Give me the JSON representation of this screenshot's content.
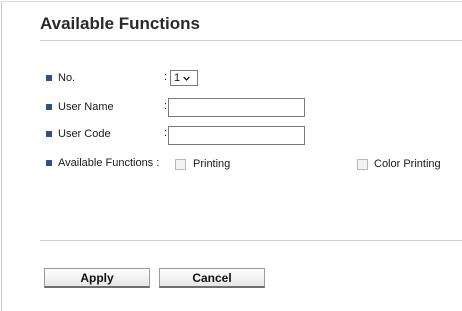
{
  "title": "Available Functions",
  "fields": {
    "no": {
      "label": "No.",
      "colon": ":",
      "value": "1"
    },
    "user_name": {
      "label": "User Name",
      "colon": ":",
      "value": ""
    },
    "user_code": {
      "label": "User Code",
      "colon": ":",
      "value": ""
    },
    "available_functions": {
      "label": "Available Functions :",
      "options": [
        {
          "label": "Printing",
          "checked": false,
          "enabled": false
        },
        {
          "label": "Color Printing",
          "checked": false,
          "enabled": false
        }
      ]
    }
  },
  "buttons": {
    "apply": "Apply",
    "cancel": "Cancel"
  },
  "colors": {
    "bullet": "#2f4f8f",
    "divider": "#cfcfcf"
  }
}
